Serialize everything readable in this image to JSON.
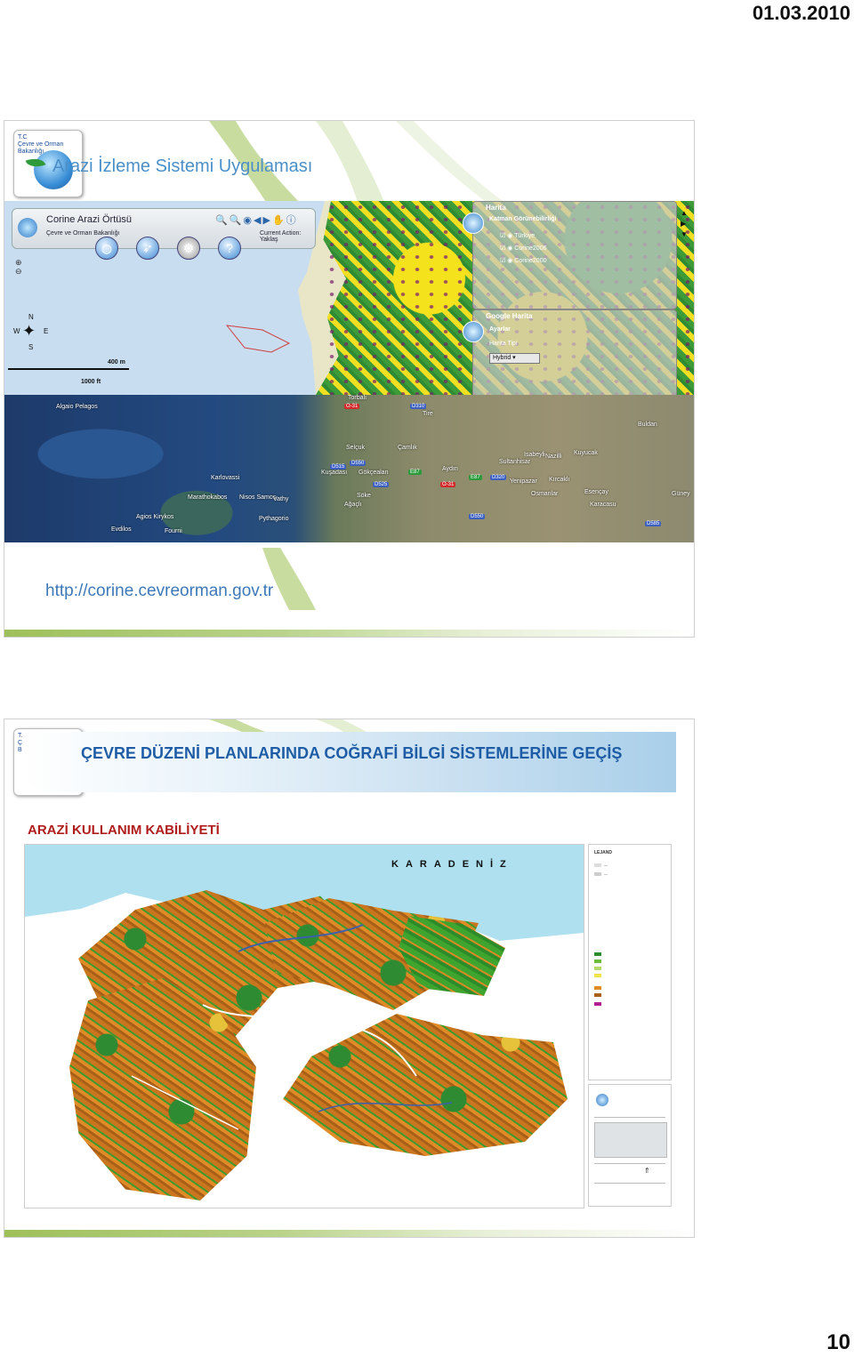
{
  "header": {
    "date": "01.03.2010"
  },
  "footer": {
    "page_number": "10"
  },
  "slide1": {
    "logo_text": [
      "T.C",
      "Çevre ve Orman",
      "Bakanlığı"
    ],
    "title": "Arazi İzleme Sistemi Uygulaması",
    "url": "http://corine.cevreorman.gov.tr",
    "app": {
      "title": "Corine Arazi Örtüsü",
      "subtitle": "Çevre ve Orman Bakanlığı",
      "current_action": "Current Action: Yaklaş"
    },
    "layers_panel": {
      "header": "Harita",
      "section": "Katman Görünebilirliği",
      "layers": [
        "Türkiye",
        "Corine2006",
        "Corine2000"
      ]
    },
    "google_panel": {
      "header": "Google Harita",
      "section": "Ayarlar",
      "type_label": "Harita Tipi",
      "type_value": "Hybrid"
    },
    "scale": {
      "upper": "400 m",
      "lower": "1000 ft"
    },
    "compass": {
      "n": "N",
      "s": "S",
      "e": "E",
      "w": "W"
    },
    "map_labels": {
      "places": [
        "Algaio Pelagos",
        "Selçuk",
        "Kuşadası",
        "Gökçealan",
        "Söke",
        "Ağaçlı",
        "Aydın",
        "Sultanhisar",
        "Yenipazar",
        "Nazilli",
        "Isabeyli",
        "Kuyucak",
        "Buldan",
        "Tire",
        "Torbalı",
        "Çamlık",
        "Karlovassi",
        "Marathokabos",
        "Nisos Samos",
        "Vathy",
        "Pythagorio",
        "Agios Kirykos",
        "Evdilos",
        "Fourni",
        "Esençay",
        "Karacasu",
        "Kırcaklı",
        "Osmanlar",
        "Güney"
      ],
      "roads": [
        "O-31",
        "D310",
        "D515",
        "D550",
        "D525",
        "E87",
        "D320",
        "E87",
        "D550",
        "D585",
        "O-31"
      ]
    }
  },
  "slide2": {
    "logo_text": [
      "T.C",
      "Çe",
      "Ba"
    ],
    "title": "ÇEVRE DÜZENİ PLANLARINDA COĞRAFİ BİLGİ SİSTEMLERİNE GEÇİŞ",
    "subtitle": "ARAZİ KULLANIM KABİLİYETİ",
    "map": {
      "sea_label": "KARADENİZ",
      "legend": {
        "title": "LEJAND",
        "colors": [
          "#2e8b32",
          "#6cbf3a",
          "#b7d86a",
          "#efe24a",
          "#e08b26",
          "#c9761f",
          "#a85f18",
          "#b02090"
        ]
      }
    }
  }
}
